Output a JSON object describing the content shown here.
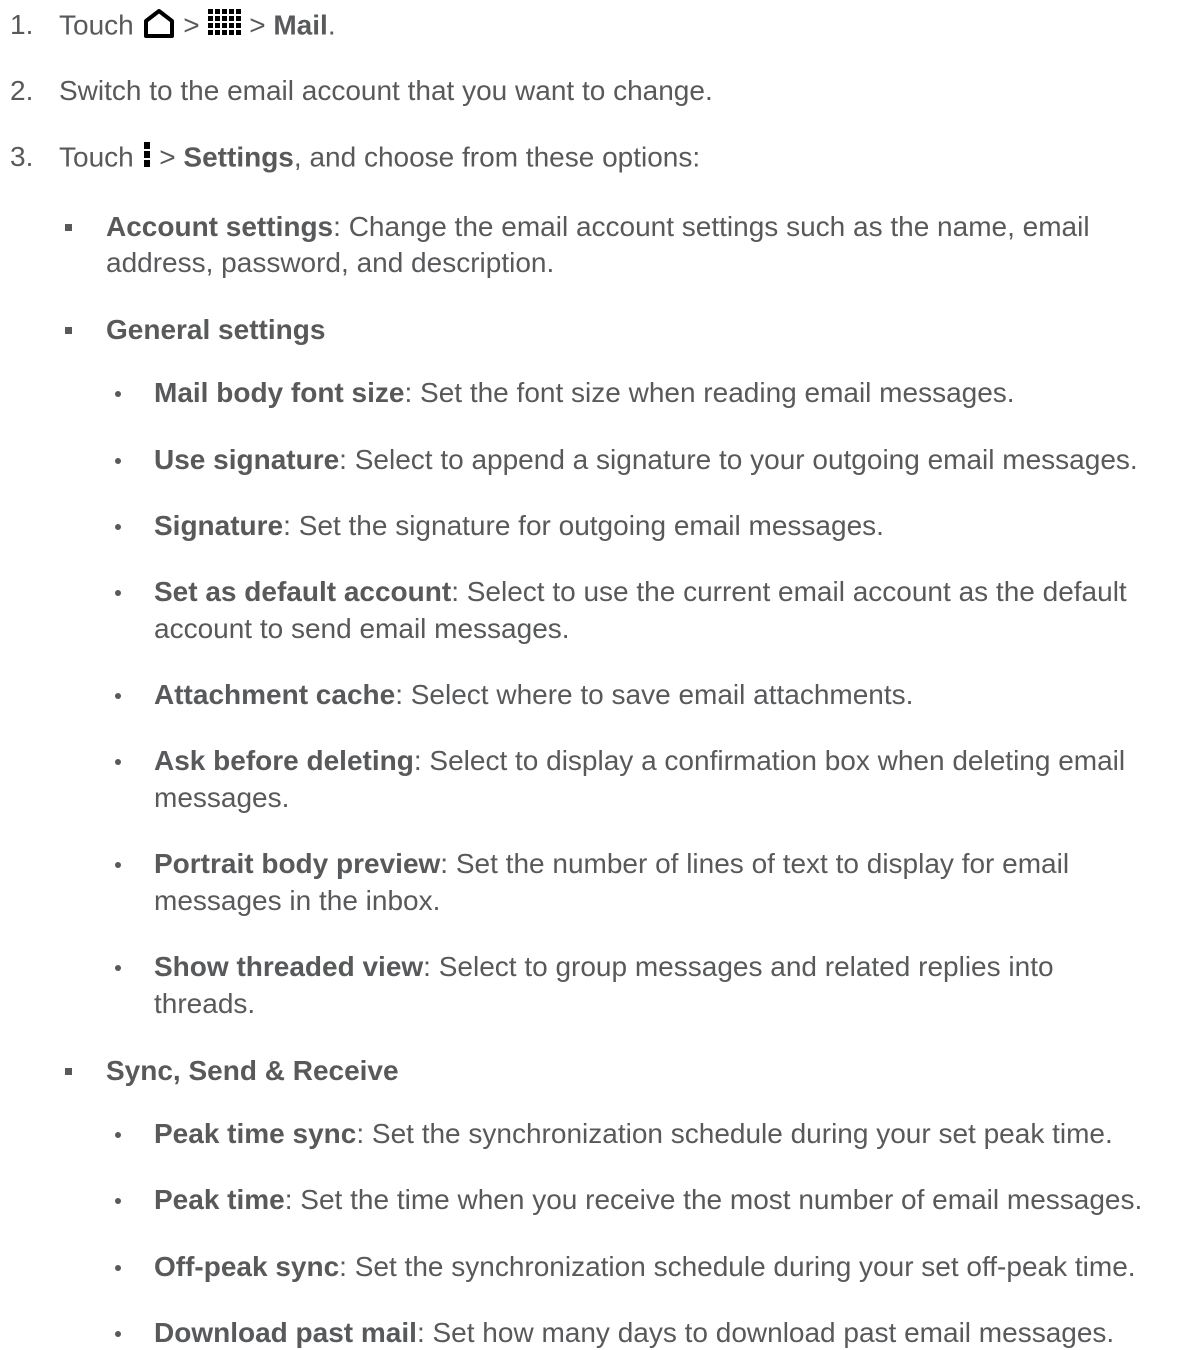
{
  "steps": [
    {
      "num": "1.",
      "pre": "Touch",
      "sep1": ">",
      "sep2": ">",
      "bold": "Mail",
      "post": "."
    },
    {
      "num": "2.",
      "text": "Switch to the email account that you want to change."
    },
    {
      "num": "3.",
      "pre": "Touch",
      "sep": ">",
      "bold": "Settings",
      "post": ", and choose from these options:"
    }
  ],
  "sections": [
    {
      "title": "Account settings",
      "desc_line1": ": Change the email account settings such as the name, email",
      "desc_line2": "address, password, and description."
    },
    {
      "title": "General settings"
    },
    {
      "title": "Sync, Send & Receive"
    }
  ],
  "general_items": [
    {
      "title": "Mail body font size",
      "desc": ": Set the font size when reading email messages."
    },
    {
      "title": "Use signature",
      "desc": ": Select to append a signature to your outgoing email messages."
    },
    {
      "title": "Signature",
      "desc": ": Set the signature for outgoing email messages."
    },
    {
      "title": "Set as default account",
      "desc": ": Select to use the current email account as the default",
      "desc2": "account to send email messages."
    },
    {
      "title": "Attachment cache",
      "desc": ": Select where to save email attachments."
    },
    {
      "title": "Ask before deleting",
      "desc": ": Select to display a confirmation box when deleting email",
      "desc2": "messages."
    },
    {
      "title": "Portrait body preview",
      "desc": ": Set the number of lines of text to display for email",
      "desc2": "messages in the inbox."
    },
    {
      "title": "Show threaded view",
      "desc": ": Select to group messages and related replies into",
      "desc2": "threads."
    }
  ],
  "sync_items": [
    {
      "title": "Peak time sync",
      "desc": ": Set the synchronization schedule during your set peak time."
    },
    {
      "title": "Peak time",
      "desc": ": Set the time when you receive the most number of email messages."
    },
    {
      "title": "Off-peak sync",
      "desc": ": Set the synchronization schedule during your set off-peak time."
    },
    {
      "title": "Download past mail",
      "desc": ": Set how many days to download past email messages."
    }
  ],
  "icons": {
    "home": "home-icon",
    "apps": "apps-grid-icon",
    "menu": "overflow-menu-icon"
  }
}
